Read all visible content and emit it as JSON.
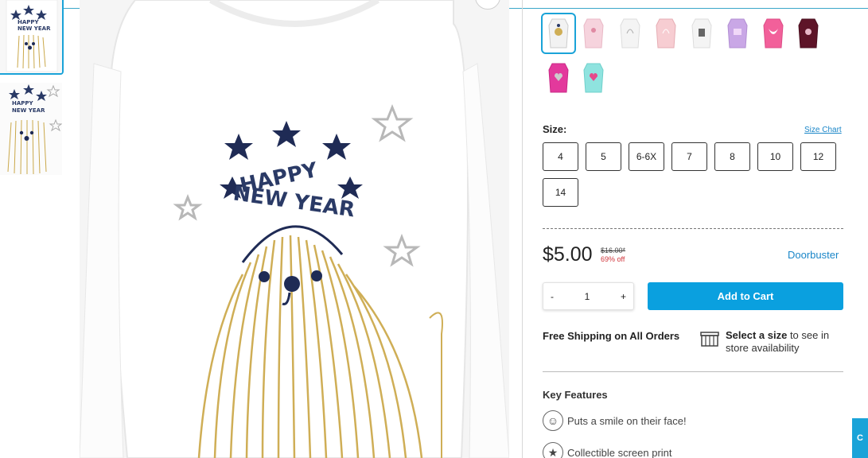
{
  "thumbnails": [
    {
      "alt": "front-view"
    },
    {
      "alt": "detail-view"
    }
  ],
  "main_image": {
    "alt": "happy new year dog tee"
  },
  "swatches": [
    {
      "name": "white-dog",
      "color": "#f2f2f2",
      "selected": true
    },
    {
      "name": "pink-ballerina",
      "color": "#f6d3dd",
      "selected": false
    },
    {
      "name": "white-unicorn",
      "color": "#f4f4f4",
      "selected": false
    },
    {
      "name": "pink-unicorn",
      "color": "#f7cdd2",
      "selected": false
    },
    {
      "name": "white-cat",
      "color": "#f4f4f4",
      "selected": false
    },
    {
      "name": "lavender",
      "color": "#c9a7e6",
      "selected": false
    },
    {
      "name": "hot-pink-butterfly",
      "color": "#f2609a",
      "selected": false
    },
    {
      "name": "burgundy",
      "color": "#5e1428",
      "selected": false
    },
    {
      "name": "magenta-heart",
      "color": "#e3399c",
      "selected": false
    },
    {
      "name": "mint-heart",
      "color": "#8fe3df",
      "selected": false
    }
  ],
  "size": {
    "label": "Size:",
    "chart_link": "Size Chart",
    "options": [
      "4",
      "5",
      "6-6X",
      "7",
      "8",
      "10",
      "12",
      "14"
    ]
  },
  "price": {
    "current": "$5.00",
    "original": "$16.00*",
    "discount": "69% off",
    "badge": "Doorbuster"
  },
  "quantity": {
    "minus": "-",
    "value": "1",
    "plus": "+"
  },
  "add_to_cart": "Add to Cart",
  "shipping": {
    "free_text": "Free Shipping on All Orders",
    "store_bold": "Select a size",
    "store_rest": " to see in store availability"
  },
  "key_features": {
    "title": "Key Features",
    "items": [
      "Puts a smile on their face!",
      "Collectible screen print"
    ]
  },
  "chat_tab": "C"
}
